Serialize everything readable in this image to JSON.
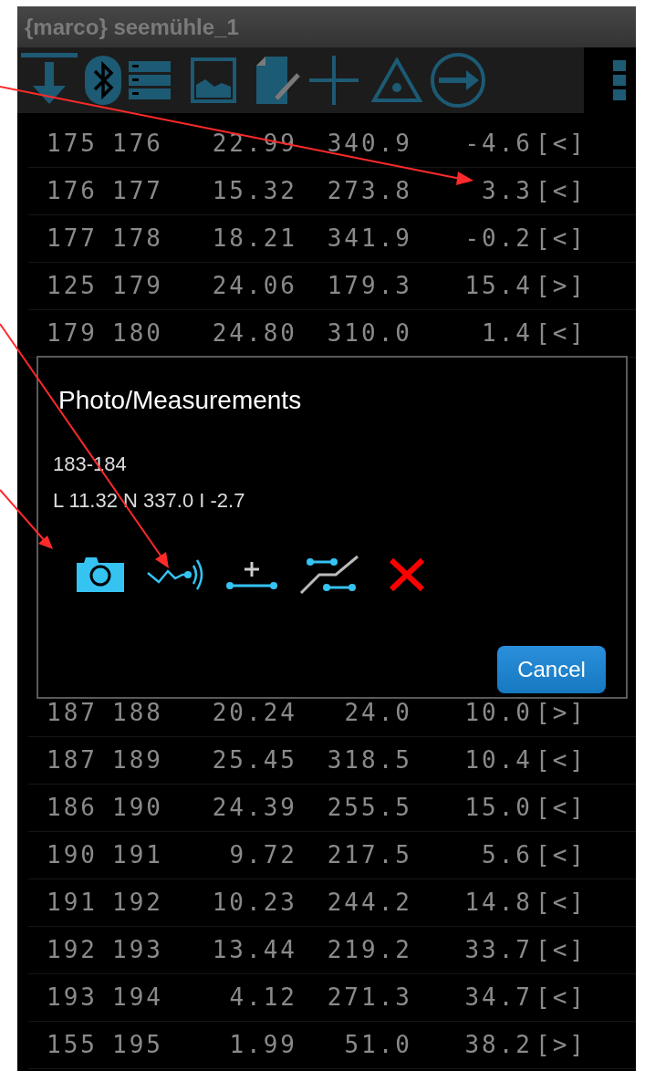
{
  "title_bar": {
    "title": "{marco} seemühle_1"
  },
  "rows": [
    {
      "cells": [
        "175",
        "176",
        "22.99",
        "340.9",
        "-4.6",
        "[<]"
      ]
    },
    {
      "cells": [
        "176",
        "177",
        "15.32",
        "273.8",
        "3.3",
        "[<]"
      ]
    },
    {
      "cells": [
        "177",
        "178",
        "18.21",
        "341.9",
        "-0.2",
        "[<]"
      ]
    },
    {
      "cells": [
        "125",
        "179",
        "24.06",
        "179.3",
        "15.4",
        "[>]"
      ]
    },
    {
      "cells": [
        "179",
        "180",
        "24.80",
        "310.0",
        "1.4",
        "[<]"
      ]
    }
  ],
  "rows_below_dialog": [
    {
      "cells": [
        "187",
        "188",
        "20.24",
        "24.0",
        "10.0",
        "[>]"
      ]
    },
    {
      "cells": [
        "187",
        "189",
        "25.45",
        "318.5",
        "10.4",
        "[<]"
      ]
    },
    {
      "cells": [
        "186",
        "190",
        "24.39",
        "255.5",
        "15.0",
        "[<]"
      ]
    },
    {
      "cells": [
        "190",
        "191",
        "9.72",
        "217.5",
        "5.6",
        "[<]"
      ]
    },
    {
      "cells": [
        "191",
        "192",
        "10.23",
        "244.2",
        "14.8",
        "[<]"
      ]
    },
    {
      "cells": [
        "192",
        "193",
        "13.44",
        "219.2",
        "33.7",
        "[<]"
      ]
    },
    {
      "cells": [
        "193",
        "194",
        "4.12",
        "271.3",
        "34.7",
        "[<]"
      ]
    },
    {
      "cells": [
        "155",
        "195",
        "1.99",
        "51.0",
        "38.2",
        "[>]"
      ]
    }
  ],
  "dialog": {
    "title": "Photo/Measurements",
    "lines": [
      "183-184",
      "L 11.32 N 337.0 I -2.7"
    ],
    "buttons": [
      {
        "label": "Cancel"
      }
    ]
  }
}
